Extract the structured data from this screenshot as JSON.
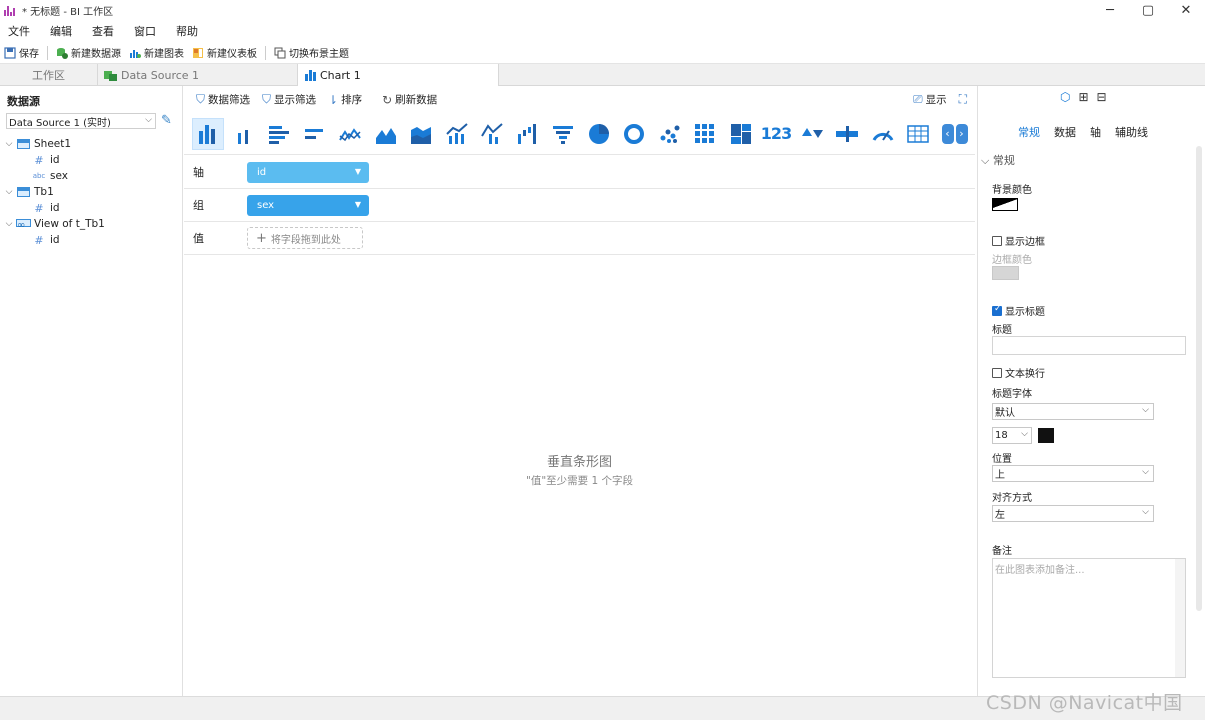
{
  "window": {
    "title": "* 无标题 - BI 工作区",
    "controls": [
      "─",
      "▢",
      "✕"
    ]
  },
  "menu": [
    "文件",
    "编辑",
    "查看",
    "窗口",
    "帮助"
  ],
  "toolbar": {
    "save": "保存",
    "new_datasource": "新建数据源",
    "new_chart": "新建图表",
    "new_dashboard": "新建仪表板",
    "switch_theme": "切换布景主题"
  },
  "doc_tabs": [
    "工作区",
    "Data Source 1",
    "Chart 1"
  ],
  "left_panel": {
    "title": "数据源",
    "datasource_select": "Data Source 1 (实时)",
    "tree": [
      {
        "label": "Sheet1",
        "fields": [
          {
            "icon": "#",
            "label": "id"
          },
          {
            "icon": "abc",
            "label": "sex"
          }
        ]
      },
      {
        "label": "Tb1",
        "fields": [
          {
            "icon": "#",
            "label": "id"
          }
        ]
      },
      {
        "label": "View of t_Tb1",
        "fields": [
          {
            "icon": "#",
            "label": "id"
          }
        ]
      }
    ]
  },
  "chart_tools": {
    "data_filter": "数据筛选",
    "display_filter": "显示筛选",
    "sort": "排序",
    "refresh": "刷新数据",
    "display": "显示"
  },
  "chart_types": [
    "vertical-bar",
    "vertical-bar-thin",
    "horizontal-bar",
    "horizontal-bar-thin",
    "line",
    "area",
    "area-stacked",
    "bar-line",
    "line-combo",
    "waterfall",
    "funnel",
    "pie",
    "donut",
    "scatter",
    "heatmap",
    "treemap",
    "value",
    "up-down",
    "bullet",
    "gauge",
    "table"
  ],
  "value_label": "123",
  "shelves": {
    "axis_label": "轴",
    "axis_value": "id",
    "group_label": "组",
    "group_value": "sex",
    "value_label": "值",
    "value_hint": "将字段拖到此处"
  },
  "placeholder": {
    "title": "垂直条形图",
    "subtitle": "\"值\"至少需要 1 个字段"
  },
  "right_panel": {
    "tabs": [
      "常规",
      "数据",
      "轴",
      "辅助线"
    ],
    "section": "常规",
    "bg_color_label": "背景颜色",
    "show_border_label": "显示边框",
    "border_color_label": "边框颜色",
    "show_title_label": "显示标题",
    "title_label": "标题",
    "title_value": "",
    "wrap_label": "文本换行",
    "title_font_label": "标题字体",
    "title_font_value": "默认",
    "font_size_value": "18",
    "position_label": "位置",
    "position_value": "上",
    "align_label": "对齐方式",
    "align_value": "左",
    "note_label": "备注",
    "note_placeholder": "在此图表添加备注..."
  },
  "watermark": "CSDN @Navicat中国",
  "colors": {
    "accent": "#1a7bd6",
    "pill_axis": "#5bbcf0",
    "pill_group": "#37a3ea",
    "chart_icon_blue": "#1a7bd6",
    "chart_icon_dark": "#1f5fa8"
  }
}
